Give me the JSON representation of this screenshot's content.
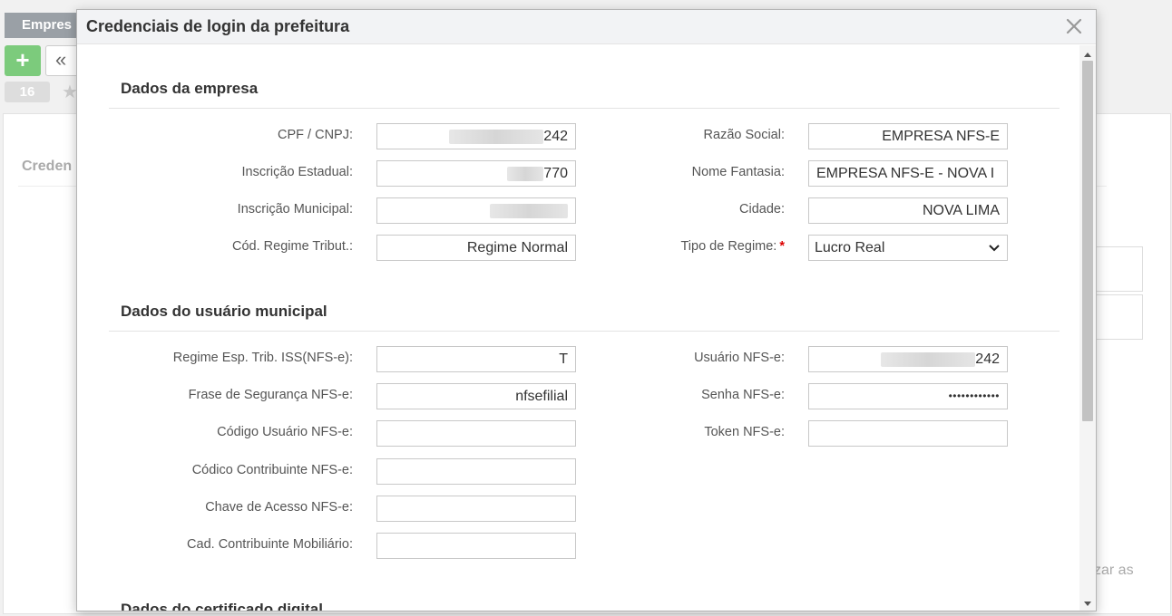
{
  "background": {
    "tab_label": "Empres",
    "add_label": "+",
    "prev_label": "«",
    "count": "16",
    "section_label": "Creden",
    "trailing_text": "zar as"
  },
  "modal": {
    "title": "Credenciais de login da prefeitura",
    "sections": {
      "empresa": "Dados da empresa",
      "usuario": "Dados do usuário municipal",
      "certificado": "Dados do certificado digital"
    },
    "empresa": {
      "cpf_cnpj_label": "CPF / CNPJ:",
      "cpf_cnpj_value": "242",
      "inscricao_estadual_label": "Inscrição Estadual:",
      "inscricao_estadual_value": "770",
      "inscricao_municipal_label": "Inscrição Municipal:",
      "regime_tribut_label": "Cód. Regime Tribut.:",
      "regime_tribut_value": "Regime Normal",
      "razao_social_label": "Razão Social:",
      "razao_social_value": "EMPRESA NFS-E",
      "nome_fantasia_label": "Nome Fantasia:",
      "nome_fantasia_value": "EMPRESA NFS-E - NOVA I",
      "cidade_label": "Cidade:",
      "cidade_value": "NOVA LIMA",
      "tipo_regime_label": "Tipo de Regime:",
      "tipo_regime_required": "*",
      "tipo_regime_value": "Lucro Real"
    },
    "usuario": {
      "regime_esp_label": "Regime Esp. Trib. ISS(NFS-e):",
      "regime_esp_value": "T",
      "frase_seguranca_label": "Frase de Segurança NFS-e:",
      "frase_seguranca_value": "nfsefilial",
      "codigo_usuario_label": "Código Usuário NFS-e:",
      "codigo_usuario_value": "",
      "codico_contribuinte_label": "Códico Contribuinte NFS-e:",
      "codico_contribuinte_value": "",
      "chave_acesso_label": "Chave de Acesso NFS-e:",
      "chave_acesso_value": "",
      "cad_contribuinte_label": "Cad. Contribuinte Mobiliário:",
      "cad_contribuinte_value": "",
      "usuario_nfse_label": "Usuário NFS-e:",
      "usuario_nfse_value": "242",
      "senha_nfse_label": "Senha NFS-e:",
      "senha_nfse_value": "••••••••••••",
      "token_nfse_label": "Token NFS-e:",
      "token_nfse_value": ""
    }
  }
}
